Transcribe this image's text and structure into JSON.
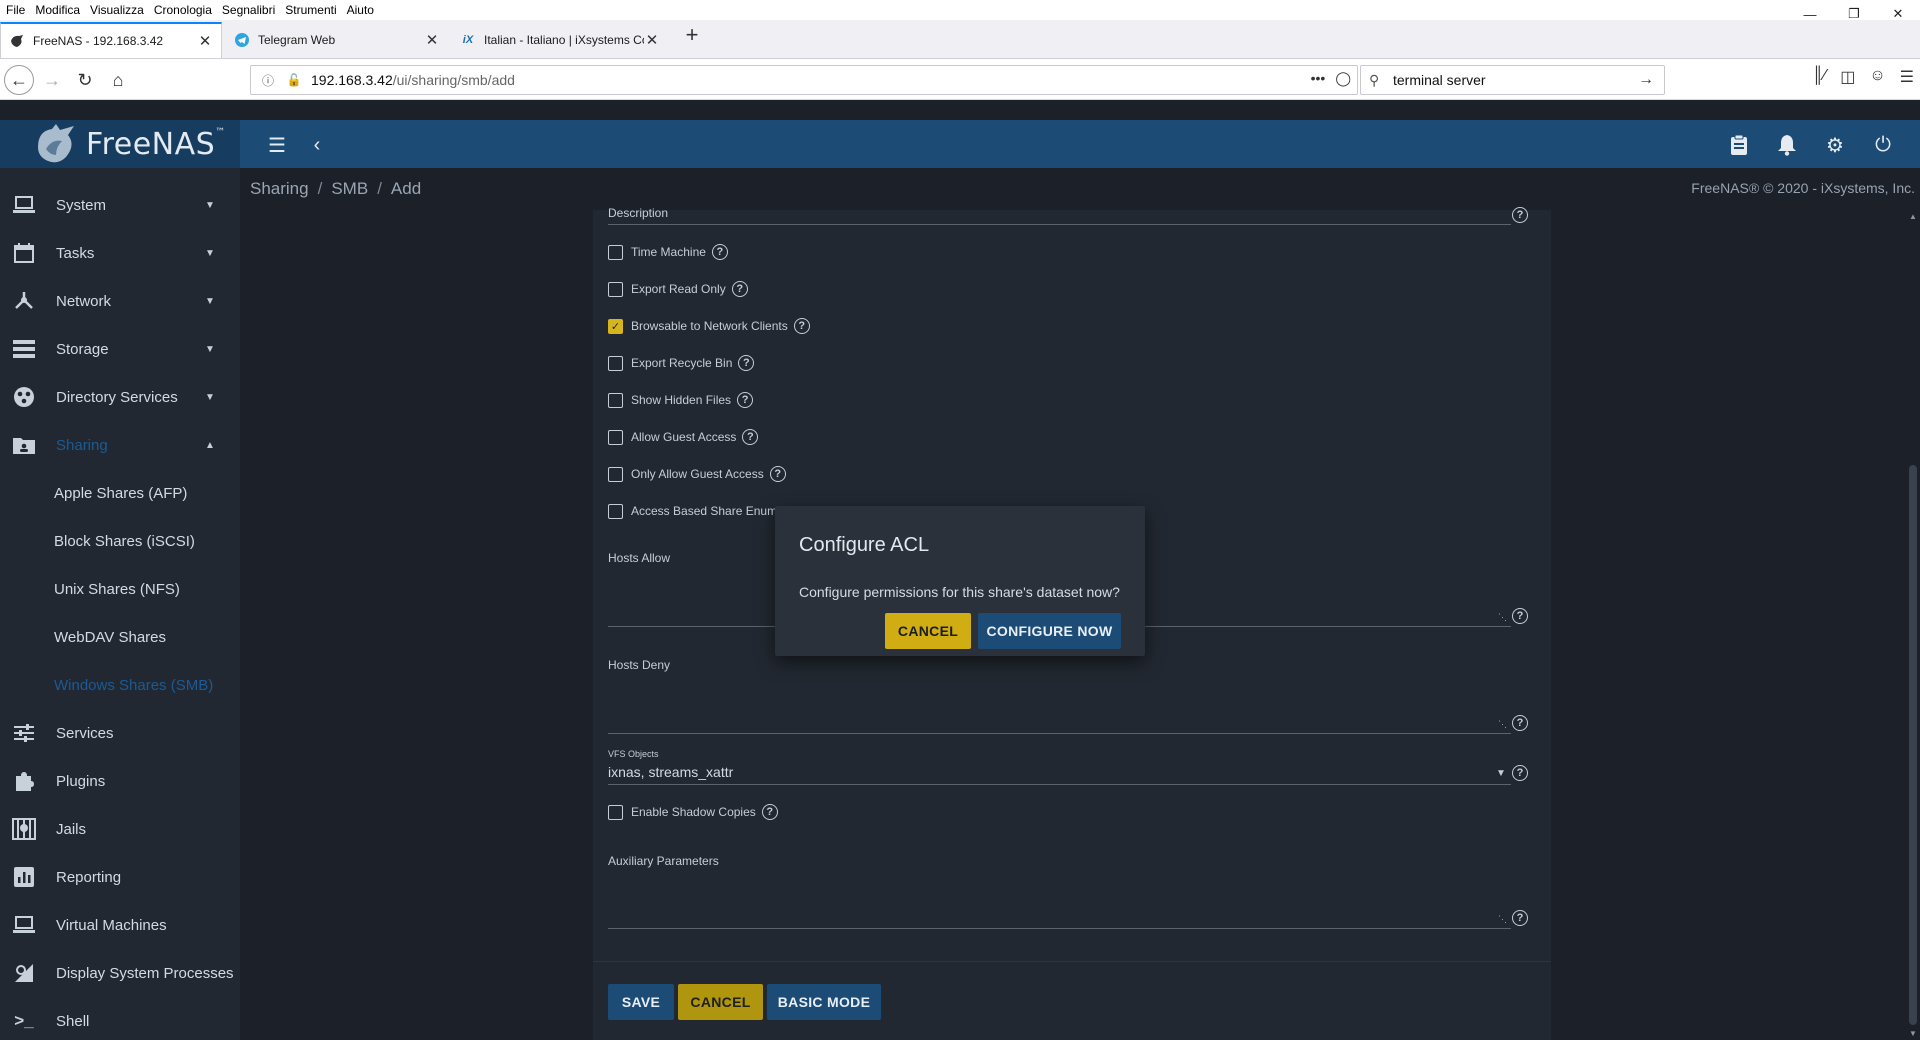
{
  "browser": {
    "menu": [
      "File",
      "Modifica",
      "Visualizza",
      "Cronologia",
      "Segnalibri",
      "Strumenti",
      "Aiuto"
    ],
    "tabs": [
      {
        "title": "FreeNAS - 192.168.3.42",
        "active": true
      },
      {
        "title": "Telegram Web",
        "active": false
      },
      {
        "title": "Italian - Italiano | iXsystems Co",
        "active": false
      }
    ],
    "url_host": "192.168.3.42",
    "url_path": "/ui/sharing/smb/add",
    "search_value": "terminal server"
  },
  "app": {
    "logo": "FreeNAS",
    "breadcrumb": [
      "Sharing",
      "SMB",
      "Add"
    ],
    "copyright": "FreeNAS® © 2020 - iXsystems, Inc."
  },
  "sidebar": {
    "items": [
      {
        "label": "System",
        "icon": "laptop-icon",
        "caret": "down"
      },
      {
        "label": "Tasks",
        "icon": "calendar-icon",
        "caret": "down"
      },
      {
        "label": "Network",
        "icon": "network-icon",
        "caret": "down"
      },
      {
        "label": "Storage",
        "icon": "storage-icon",
        "caret": "down"
      },
      {
        "label": "Directory Services",
        "icon": "directory-icon",
        "caret": "down"
      },
      {
        "label": "Sharing",
        "icon": "folder-shared-icon",
        "caret": "up",
        "active": true
      }
    ],
    "sharing_sub": [
      {
        "label": "Apple Shares (AFP)"
      },
      {
        "label": "Block Shares (iSCSI)"
      },
      {
        "label": "Unix Shares (NFS)"
      },
      {
        "label": "WebDAV Shares"
      },
      {
        "label": "Windows Shares (SMB)",
        "active": true
      }
    ],
    "items_after": [
      {
        "label": "Services",
        "icon": "tune-icon"
      },
      {
        "label": "Plugins",
        "icon": "puzzle-icon"
      },
      {
        "label": "Jails",
        "icon": "jail-icon"
      },
      {
        "label": "Reporting",
        "icon": "chart-icon"
      },
      {
        "label": "Virtual Machines",
        "icon": "computer-icon"
      },
      {
        "label": "Display System Processes",
        "icon": "processes-icon"
      },
      {
        "label": "Shell",
        "icon": "terminal-icon"
      }
    ]
  },
  "form": {
    "description_label": "Description",
    "checkboxes": [
      {
        "label": "Time Machine",
        "checked": false
      },
      {
        "label": "Export Read Only",
        "checked": false
      },
      {
        "label": "Browsable to Network Clients",
        "checked": true
      },
      {
        "label": "Export Recycle Bin",
        "checked": false
      },
      {
        "label": "Show Hidden Files",
        "checked": false
      },
      {
        "label": "Allow Guest Access",
        "checked": false
      },
      {
        "label": "Only Allow Guest Access",
        "checked": false
      },
      {
        "label": "Access Based Share Enum",
        "checked": false
      }
    ],
    "hosts_allow_label": "Hosts Allow",
    "hosts_deny_label": "Hosts Deny",
    "vfs_label": "VFS Objects",
    "vfs_value": "ixnas, streams_xattr",
    "shadow_copies_label": "Enable Shadow Copies",
    "aux_label": "Auxiliary Parameters",
    "save_label": "SAVE",
    "cancel_label": "CANCEL",
    "basic_mode_label": "BASIC MODE"
  },
  "dialog": {
    "title": "Configure ACL",
    "message": "Configure permissions for this share's dataset now?",
    "cancel_label": "CANCEL",
    "confirm_label": "CONFIGURE NOW"
  },
  "colors": {
    "topbar": "#1c4b76",
    "accent_yellow": "#cfad13",
    "active_link": "#1b5a96"
  }
}
